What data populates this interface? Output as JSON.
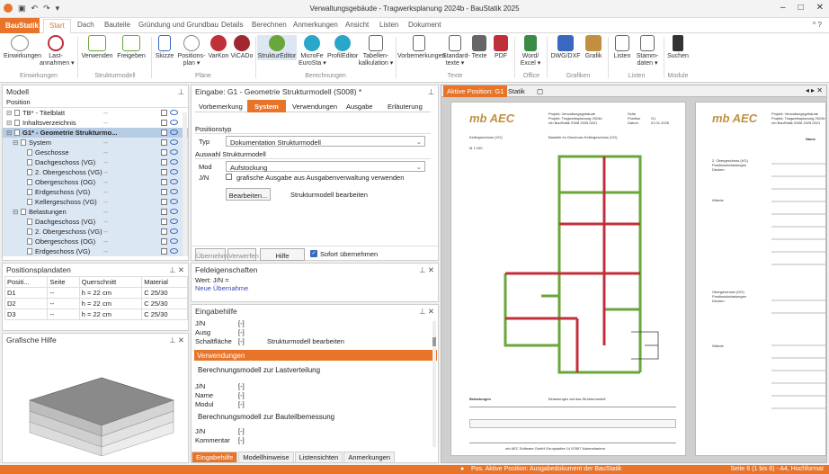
{
  "titlebar": {
    "title": "Verwaltungsgebäude - Tragwerksplanung 2024b - BauStatik 2025",
    "qa_icons": [
      "logo-icon",
      "save-icon",
      "undo-icon",
      "redo-icon",
      "customize-icon"
    ],
    "window": [
      "minimize-icon",
      "maximize-icon",
      "close-icon"
    ]
  },
  "tabs": {
    "app": "BauStatik",
    "items": [
      "Start",
      "Dach",
      "Bauteile",
      "Gründung und Grundbau",
      "Details",
      "Berechnen",
      "Anmerkungen",
      "Ansicht",
      "Listen",
      "Dokument"
    ],
    "help": "^ ?"
  },
  "ribbon": {
    "buttons": [
      {
        "label": "Einwirkungen",
        "icon": "einwirkungen-icon"
      },
      {
        "label": "Last-\nannahmen ▾",
        "icon": "lastannahmen-icon"
      },
      {
        "label": "Verwenden",
        "icon": "verwenden-icon"
      },
      {
        "label": "Freigeben",
        "icon": "freigeben-icon"
      },
      {
        "label": "Skizze",
        "icon": "skizze-icon"
      },
      {
        "label": "Positions-\nplan ▾",
        "icon": "positionsplan-icon"
      },
      {
        "label": "VarKon",
        "icon": "varkon-icon"
      },
      {
        "label": "ViCADo",
        "icon": "vicado-icon"
      },
      {
        "label": "StrukturEditor",
        "icon": "struktureditor-icon"
      },
      {
        "label": "MicroFe\nEuroSta ▾",
        "icon": "microfe-icon"
      },
      {
        "label": "ProfilEditor",
        "icon": "profileditor-icon"
      },
      {
        "label": "Tabellen-\nkalkulation ▾",
        "icon": "tabellen-icon"
      },
      {
        "label": "Vorbemerkungen",
        "icon": "vorbemerkungen-icon"
      },
      {
        "label": "Standard-\ntexte ▾",
        "icon": "standardtexte-icon"
      },
      {
        "label": "Texte",
        "icon": "texte-icon"
      },
      {
        "label": "PDF",
        "icon": "pdf-icon"
      },
      {
        "label": "Word/\nExcel ▾",
        "icon": "word-icon"
      },
      {
        "label": "DWG/DXF",
        "icon": "dwg-icon"
      },
      {
        "label": "Grafik",
        "icon": "grafik-icon"
      },
      {
        "label": "Listen",
        "icon": "listen-icon"
      },
      {
        "label": "Stamm-\ndaten ▾",
        "icon": "stammdaten-icon"
      },
      {
        "label": "Suchen",
        "icon": "suchen-icon"
      }
    ],
    "groups": [
      "Einwirkungen",
      "Strukturmodell",
      "Pläne",
      "Berechnungen",
      "Texte",
      "Office",
      "Grafiken",
      "Listen",
      "Module"
    ]
  },
  "modell": {
    "title": "Modell",
    "col": "Position",
    "rows": [
      {
        "label": "TB* - Titelblatt",
        "val": "--",
        "level": 0,
        "state": "normal"
      },
      {
        "label": "Inhaltsverzeichnis",
        "val": "--",
        "level": 0,
        "state": "normal"
      },
      {
        "label": "G1* - Geometrie Strukturmo...",
        "val": "--",
        "level": 0,
        "state": "selected"
      },
      {
        "label": "System",
        "val": "--",
        "level": 1,
        "state": "sub"
      },
      {
        "label": "Geschosse",
        "val": "--",
        "level": 2,
        "state": "sub"
      },
      {
        "label": "Dachgeschoss (VG)",
        "val": "--",
        "level": 2,
        "state": "sub"
      },
      {
        "label": "2. Obergeschoss (VG)",
        "val": "--",
        "level": 2,
        "state": "sub"
      },
      {
        "label": "Obergeschoss (OG)",
        "val": "--",
        "level": 2,
        "state": "sub"
      },
      {
        "label": "Erdgeschoss (VG)",
        "val": "--",
        "level": 2,
        "state": "sub"
      },
      {
        "label": "Kellergeschoss (VG)",
        "val": "--",
        "level": 2,
        "state": "sub"
      },
      {
        "label": "Belastungen",
        "val": "--",
        "level": 1,
        "state": "sub"
      },
      {
        "label": "Dachgeschoss (VG)",
        "val": "--",
        "level": 2,
        "state": "sub"
      },
      {
        "label": "2. Obergeschoss (VG)",
        "val": "--",
        "level": 2,
        "state": "sub"
      },
      {
        "label": "Obergeschoss (OG)",
        "val": "--",
        "level": 2,
        "state": "sub"
      },
      {
        "label": "Erdgeschoss (VG)",
        "val": "--",
        "level": 2,
        "state": "sub"
      }
    ]
  },
  "positionsplan": {
    "title": "Positionsplandaten",
    "headers": [
      "Positi...",
      "Seite",
      "Querschnitt",
      "Material"
    ],
    "rows": [
      [
        "D1",
        "--",
        "h = 22 cm",
        "C 25/30"
      ],
      [
        "D2",
        "--",
        "h = 22 cm",
        "C 25/30"
      ],
      [
        "D3",
        "--",
        "h = 22 cm",
        "C 25/30"
      ]
    ]
  },
  "grafische_hilfe": {
    "title": "Grafische Hilfe"
  },
  "eingabe": {
    "title": "Eingabe: G1 - Geometrie Strukturmodell (S008) *",
    "tabs": [
      "Vorbemerkung",
      "System",
      "Verwendungen",
      "Ausgabe",
      "Erläuterung"
    ],
    "section1": "Positionstyp",
    "typ_label": "Typ",
    "typ_value": "Dokumentation Strukturmodell",
    "section2": "Auswahl Strukturmodell",
    "mod_label": "Mod",
    "mod_value": "Aufstockung",
    "jn_label": "J/N",
    "jn_text": "grafische Ausgabe aus Ausgabenverwaltung verwenden",
    "bearbeiten": "Bearbeiten...",
    "bearbeiten_text": "Strukturmodell bearbeiten",
    "footer": {
      "uebernehmen": "Übernehmen",
      "verwerfen": "Verwerfen",
      "hilfe": "Hilfe",
      "sofort": "Sofort übernehmen"
    }
  },
  "feldeigenschaften": {
    "title": "Feldeigenschaften",
    "wert": "Wert: J/N =",
    "neu": "Neue Übernahme"
  },
  "eingabehilfe": {
    "title": "Eingabehilfe",
    "rows1": [
      [
        "J/N",
        "[-]",
        ""
      ],
      [
        "Ausg",
        "[-]",
        ""
      ],
      [
        "Schaltfläche",
        "[-]",
        "Strukturmodell bearbeiten"
      ]
    ],
    "section": "Verwendungen",
    "sub1": "Berechnungsmodell zur Lastverteilung",
    "rows2": [
      [
        "J/N",
        "[-]"
      ],
      [
        "Name",
        "[-]"
      ],
      [
        "Modul",
        "[-]"
      ]
    ],
    "sub2": "Berechnungsmodell zur Bauteilbemessung",
    "rows3": [
      [
        "J/N",
        "[-]"
      ],
      [
        "Kommentar",
        "[-]"
      ]
    ],
    "bottom_tabs": [
      "Eingabehilfe",
      "Modellhinweise",
      "Listensichten",
      "Anmerkungen"
    ]
  },
  "document": {
    "tab_active": "Aktive Position: G1",
    "tab_statik": "Statik",
    "logo": "mb AEC",
    "page_header": [
      "Projekt: Verwaltungsgebäude",
      "Projekt: Tragwerksplanung 2024b",
      "mb BauStatik S008 2025.0021"
    ],
    "page_header_right": [
      "Seite",
      "Position",
      "Datum"
    ],
    "page_header_right_vals": [
      "",
      "G1",
      "01.01.2025"
    ],
    "plan_title": "Kellergeschoss (VG)",
    "plan_sub": "Bauteile im Geschoss Kellergeschoss (VG)",
    "scale": "M 1:100",
    "belastungen": "Belastungen",
    "belastungen_text": "Belastungen auf das Strukturmodell",
    "footer": "mb AEC Software GmbH    Europaallee 14    67657 Kaiserslautern",
    "right_labels": [
      "Name",
      "EW",
      "2. Obergeschoss (VG)",
      "Positionsbelastungen",
      "Decken",
      "Wände",
      "Obergeschoss (OG)",
      "Positionsbelastungen",
      "Decken",
      "Wände"
    ]
  },
  "status": {
    "icon": "info-icon",
    "text": "Pos. Aktive Position: Ausgabedokument der BauStatik",
    "right": "Seite 6 (1 bis 8) - A4, Hochformat"
  },
  "colors": {
    "accent": "#e8742a",
    "green": "#6aa63a",
    "red": "#c0303a",
    "selected": "#b7cde6"
  }
}
